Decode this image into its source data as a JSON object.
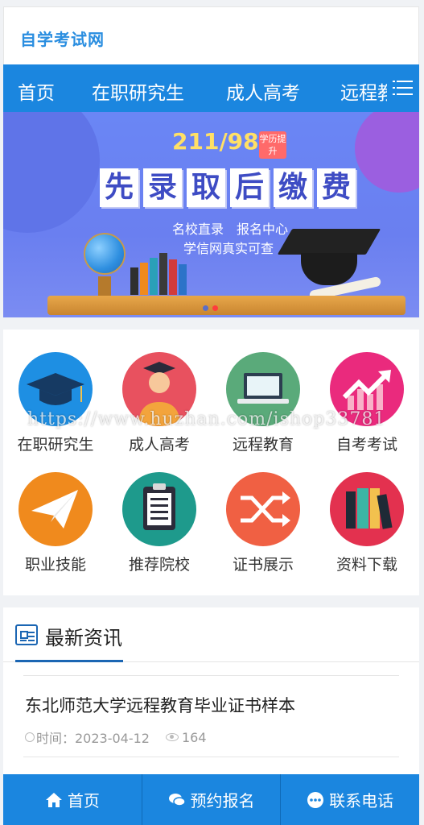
{
  "header": {
    "logo": "自学考试网"
  },
  "nav": {
    "tabs": [
      {
        "label": "首页",
        "active": true
      },
      {
        "label": "在职研究生",
        "active": false
      },
      {
        "label": "成人高考",
        "active": false
      },
      {
        "label": "远程教育",
        "active": false
      }
    ],
    "menu_icon": "list-icon"
  },
  "banner": {
    "headline_number": "211/985",
    "tag": "学历提升",
    "slogan_chars": [
      "先",
      "录",
      "取",
      "后",
      "缴",
      "费"
    ],
    "subline1": "名校直录　报名中心",
    "subline2": "学信网真实可查",
    "slide_count": 2,
    "active_slide": 2
  },
  "categories": [
    {
      "label": "在职研究生",
      "icon": "graduation-cap-icon",
      "color": "#1e8fe3"
    },
    {
      "label": "成人高考",
      "icon": "graduate-person-icon",
      "color": "#e8515f"
    },
    {
      "label": "远程教育",
      "icon": "laptop-icon",
      "color": "#5aaa7a"
    },
    {
      "label": "自考考试",
      "icon": "trending-up-icon",
      "color": "#ea2a7d"
    },
    {
      "label": "职业技能",
      "icon": "paper-plane-icon",
      "color": "#f08a1d"
    },
    {
      "label": "推荐院校",
      "icon": "clipboard-icon",
      "color": "#1e9a8c"
    },
    {
      "label": "证书展示",
      "icon": "shuffle-icon",
      "color": "#f06043"
    },
    {
      "label": "资料下载",
      "icon": "books-icon",
      "color": "#e3314f"
    }
  ],
  "news": {
    "title": "最新资讯",
    "items": [
      {
        "title": "东北师范大学远程教育毕业证书样本",
        "time": "时间：2023-04-12",
        "views": "164"
      }
    ]
  },
  "bottom_bar": [
    {
      "label": "首页",
      "icon": "home-icon"
    },
    {
      "label": "预约报名",
      "icon": "chat-icon"
    },
    {
      "label": "联系电话",
      "icon": "more-icon"
    }
  ],
  "watermark": "https://www.huzhan.com/ishop33781"
}
